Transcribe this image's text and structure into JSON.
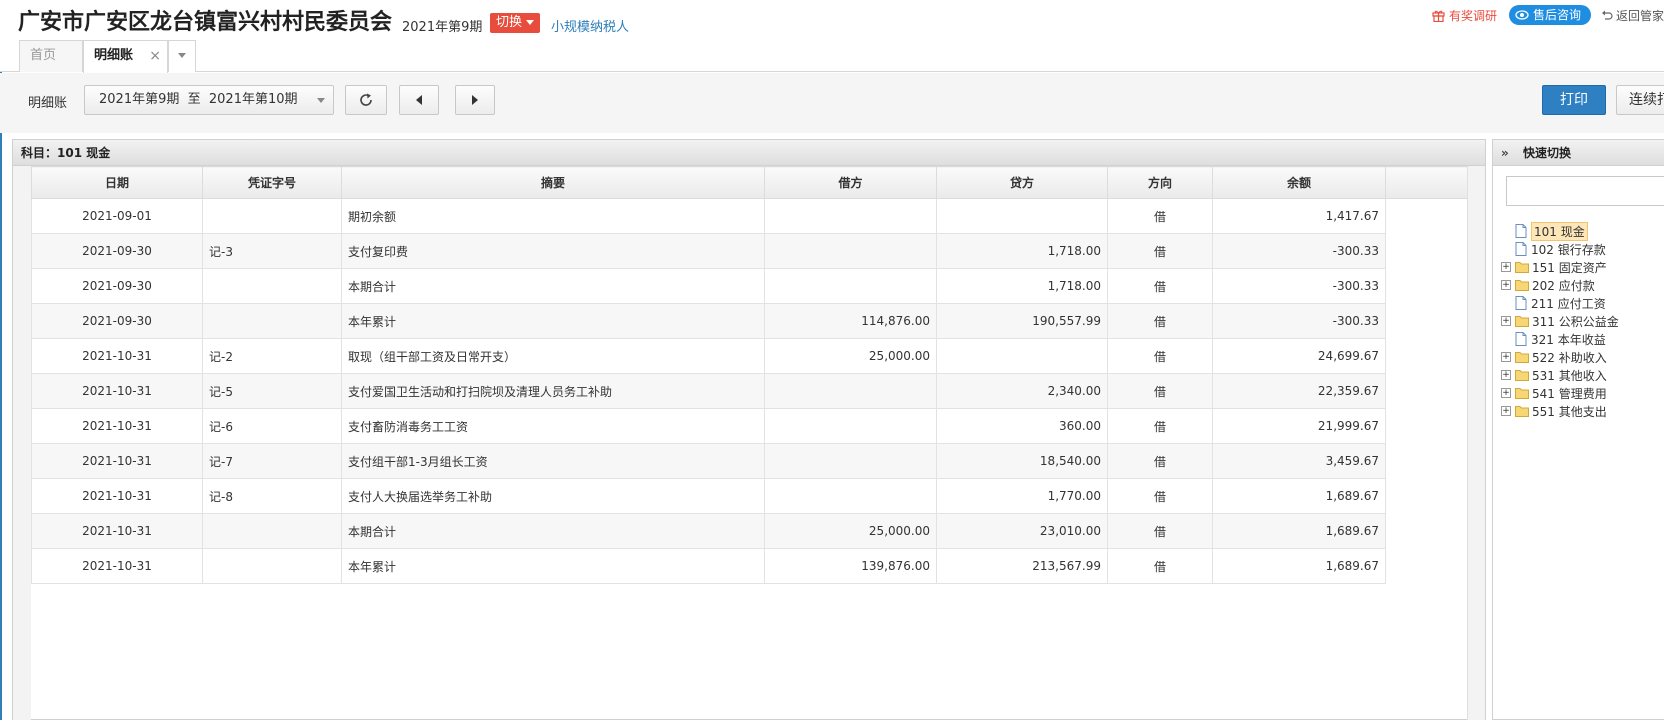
{
  "header": {
    "company": "广安市广安区龙台镇富兴村村民委员会",
    "period": "2021年第9期",
    "switch_label": "切换",
    "taxpayer_type": "小规模纳税人",
    "survey_label": "有奖调研",
    "support_label": "售后咨询",
    "back_label": "返回管家"
  },
  "tabs": [
    {
      "label": "首页"
    },
    {
      "label": "明细账",
      "close": "×"
    }
  ],
  "toolbar": {
    "label": "明细账",
    "period_range": "2021年第9期  至  2021年第10期",
    "print_label": "打印",
    "continuous_print_label": "连续打"
  },
  "ledger": {
    "subject": "科目：101  现金",
    "columns": [
      "日期",
      "凭证字号",
      "摘要",
      "借方",
      "贷方",
      "方向",
      "余额"
    ],
    "rows": [
      {
        "date": "2021-09-01",
        "voucher": "",
        "summary": "期初余额",
        "debit": "",
        "credit": "",
        "dir": "借",
        "balance": "1,417.67"
      },
      {
        "date": "2021-09-30",
        "voucher": "记-3",
        "summary": "支付复印费",
        "debit": "",
        "credit": "1,718.00",
        "dir": "借",
        "balance": "-300.33"
      },
      {
        "date": "2021-09-30",
        "voucher": "",
        "summary": "本期合计",
        "debit": "",
        "credit": "1,718.00",
        "dir": "借",
        "balance": "-300.33"
      },
      {
        "date": "2021-09-30",
        "voucher": "",
        "summary": "本年累计",
        "debit": "114,876.00",
        "credit": "190,557.99",
        "dir": "借",
        "balance": "-300.33"
      },
      {
        "date": "2021-10-31",
        "voucher": "记-2",
        "summary": "取现（组干部工资及日常开支）",
        "debit": "25,000.00",
        "credit": "",
        "dir": "借",
        "balance": "24,699.67"
      },
      {
        "date": "2021-10-31",
        "voucher": "记-5",
        "summary": "支付爱国卫生活动和打扫院坝及清理人员务工补助",
        "debit": "",
        "credit": "2,340.00",
        "dir": "借",
        "balance": "22,359.67"
      },
      {
        "date": "2021-10-31",
        "voucher": "记-6",
        "summary": "支付畜防消毒务工工资",
        "debit": "",
        "credit": "360.00",
        "dir": "借",
        "balance": "21,999.67"
      },
      {
        "date": "2021-10-31",
        "voucher": "记-7",
        "summary": "支付组干部1-3月组长工资",
        "debit": "",
        "credit": "18,540.00",
        "dir": "借",
        "balance": "3,459.67"
      },
      {
        "date": "2021-10-31",
        "voucher": "记-8",
        "summary": "支付人大换届选举务工补助",
        "debit": "",
        "credit": "1,770.00",
        "dir": "借",
        "balance": "1,689.67"
      },
      {
        "date": "2021-10-31",
        "voucher": "",
        "summary": "本期合计",
        "debit": "25,000.00",
        "credit": "23,010.00",
        "dir": "借",
        "balance": "1,689.67"
      },
      {
        "date": "2021-10-31",
        "voucher": "",
        "summary": "本年累计",
        "debit": "139,876.00",
        "credit": "213,567.99",
        "dir": "借",
        "balance": "1,689.67"
      }
    ]
  },
  "quick_switch": {
    "title": "快速切换",
    "search_value": "",
    "accounts": [
      {
        "label": "101 现金",
        "expandable": false,
        "icon": "doc-icon",
        "selected": true
      },
      {
        "label": "102 银行存款",
        "expandable": false,
        "icon": "doc-icon",
        "selected": false
      },
      {
        "label": "151 固定资产",
        "expandable": true,
        "icon": "folder-icon",
        "selected": false
      },
      {
        "label": "202 应付款",
        "expandable": true,
        "icon": "folder-icon",
        "selected": false
      },
      {
        "label": "211 应付工资",
        "expandable": false,
        "icon": "doc-icon",
        "selected": false
      },
      {
        "label": "311 公积公益金",
        "expandable": true,
        "icon": "folder-icon",
        "selected": false
      },
      {
        "label": "321 本年收益",
        "expandable": false,
        "icon": "doc-icon",
        "selected": false
      },
      {
        "label": "522 补助收入",
        "expandable": true,
        "icon": "folder-icon",
        "selected": false
      },
      {
        "label": "531 其他收入",
        "expandable": true,
        "icon": "folder-icon",
        "selected": false
      },
      {
        "label": "541 管理费用",
        "expandable": true,
        "icon": "folder-icon",
        "selected": false
      },
      {
        "label": "551 其他支出",
        "expandable": true,
        "icon": "folder-icon",
        "selected": false
      }
    ],
    "expand_glyph": "+"
  },
  "colors": {
    "accent_blue": "#2f80c2",
    "switch_red": "#e84c3d",
    "link_blue": "#2f7fb8"
  }
}
